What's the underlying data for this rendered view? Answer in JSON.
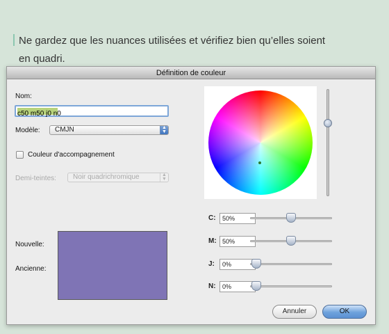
{
  "caption": {
    "line1": "Ne gardez que les nuances utilisées et vérifiez bien qu’elles soient",
    "line2": "en quadri."
  },
  "dialog": {
    "title": "Définition de couleur",
    "name_label": "Nom:",
    "name_value": "c50 m50 j0 n0",
    "model_label": "Modèle:",
    "model_value": "CMJN",
    "spot_label": "Couleur d'accompagnement",
    "spot_checked": false,
    "halftone_label": "Demi-teintes:",
    "halftone_value": "Noir quadrichromique",
    "new_label": "Nouvelle:",
    "old_label": "Ancienne:",
    "swatch_color": "#7f74b5",
    "channels": [
      {
        "label": "C:",
        "value": "50%",
        "level": 0.5
      },
      {
        "label": "M:",
        "value": "50%",
        "level": 0.5
      },
      {
        "label": "J:",
        "value": "0%",
        "level": 0
      },
      {
        "label": "N:",
        "value": "0%",
        "level": 0
      }
    ],
    "cancel_label": "Annuler",
    "ok_label": "OK"
  }
}
